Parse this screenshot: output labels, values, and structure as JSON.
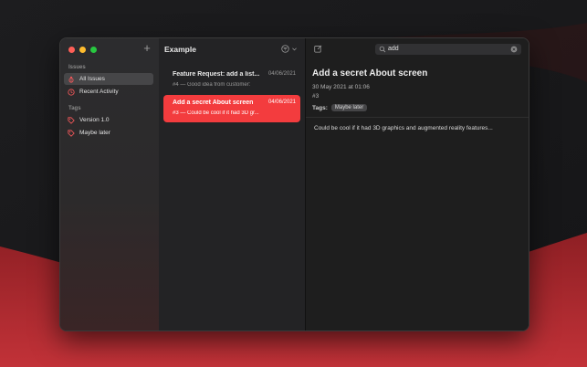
{
  "sidebar": {
    "sections": {
      "issues": "Issues",
      "tags": "Tags"
    },
    "items": [
      {
        "label": "All Issues",
        "icon": "bug-icon"
      },
      {
        "label": "Recent Activity",
        "icon": "clock-icon"
      },
      {
        "label": "Version 1.0",
        "icon": "tag-icon"
      },
      {
        "label": "Maybe later",
        "icon": "tag-icon"
      }
    ],
    "add_glyph": "+"
  },
  "list": {
    "title": "Example",
    "issues": [
      {
        "title": "Feature Request: add a list...",
        "date": "04/06/2021",
        "subtitle": "#4 — Good idea from customer:"
      },
      {
        "title": "Add a secret About screen",
        "date": "04/06/2021",
        "subtitle": "#3 — Could be cool if it had 3D gr..."
      }
    ]
  },
  "search": {
    "value": "add"
  },
  "detail": {
    "title": "Add a secret About screen",
    "date": "30 May 2021 at 01:06",
    "number": "#3",
    "tags_label": "Tags:",
    "tag": "Maybe later",
    "body": "Could be cool if it had 3D graphics and augmented reality features..."
  },
  "colors": {
    "accent": "#f33c3e",
    "wallpaper_red": "#a62a2f"
  }
}
